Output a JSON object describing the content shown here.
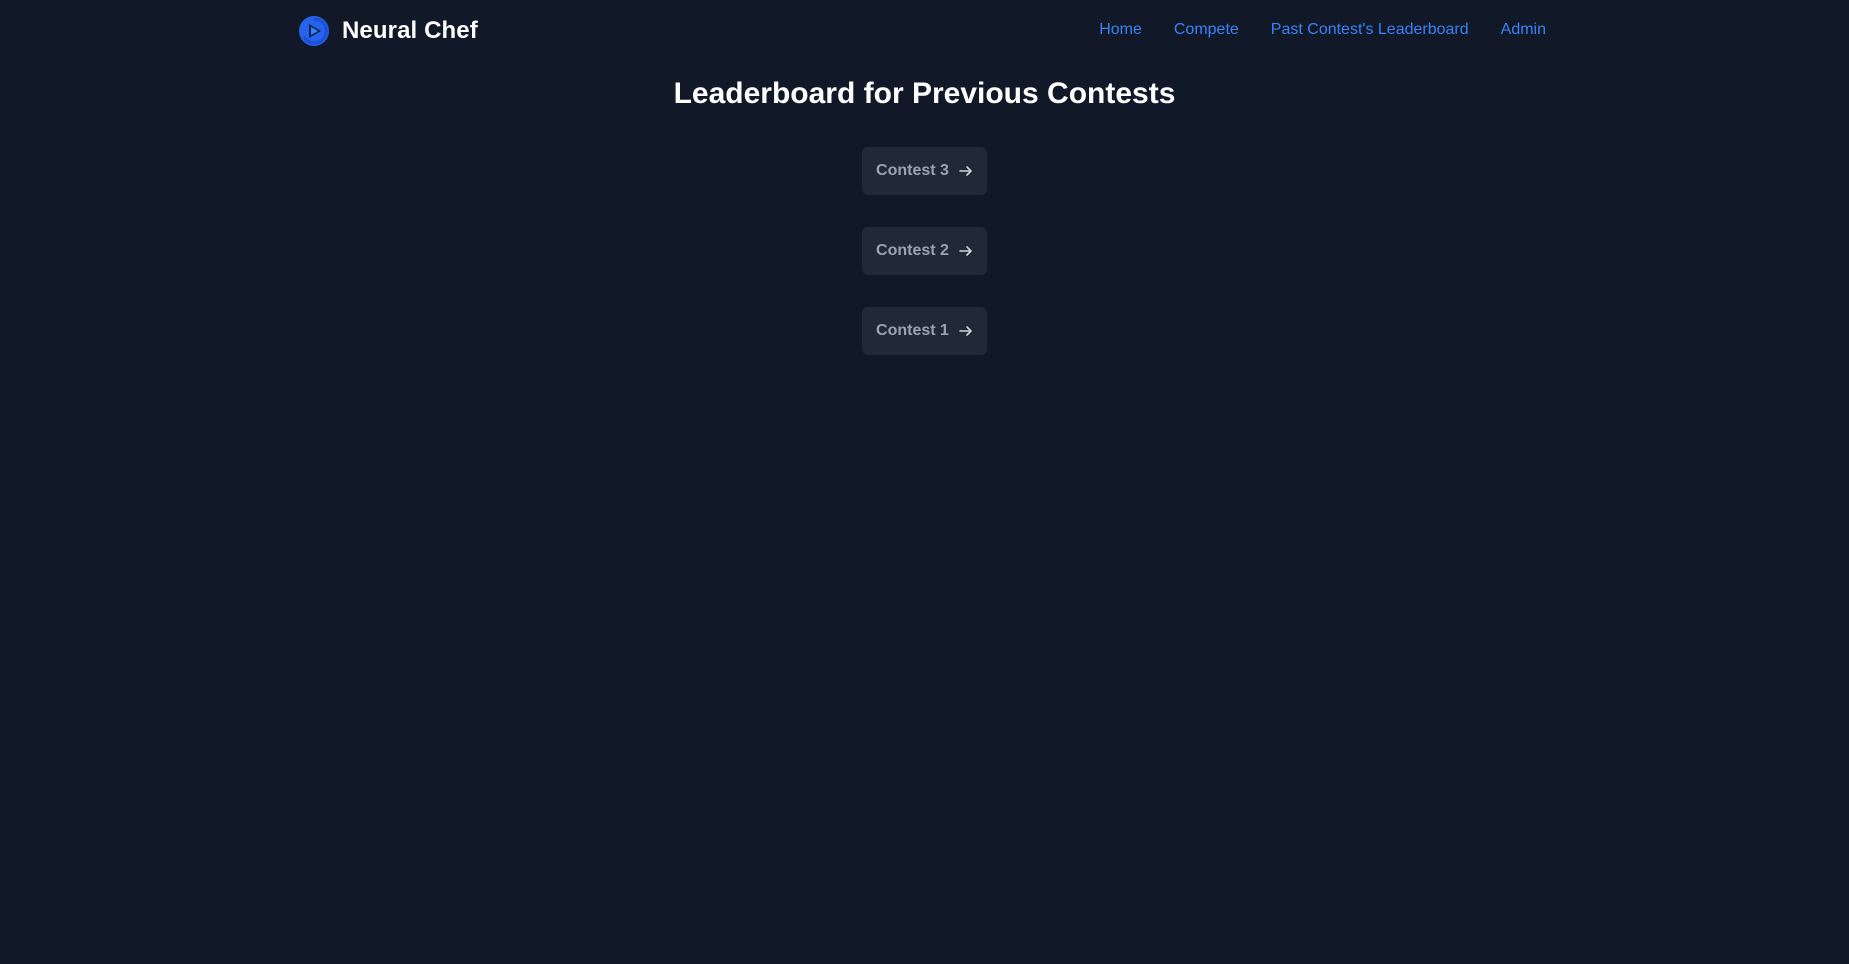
{
  "brand": {
    "name": "Neural Chef",
    "logo_icon": "play-circle-logo-icon"
  },
  "nav": {
    "items": [
      {
        "label": "Home"
      },
      {
        "label": "Compete"
      },
      {
        "label": "Past Contest's Leaderboard"
      },
      {
        "label": "Admin"
      }
    ]
  },
  "page": {
    "title": "Leaderboard for Previous Contests"
  },
  "contests": [
    {
      "label": "Contest 3",
      "icon": "arrow-right-icon"
    },
    {
      "label": "Contest 2",
      "icon": "arrow-right-icon"
    },
    {
      "label": "Contest 1",
      "icon": "arrow-right-icon"
    }
  ],
  "colors": {
    "background": "#111827",
    "card": "#1f2937",
    "link": "#3b82f6",
    "title": "#ffffff",
    "button_text": "#9ca3af"
  }
}
